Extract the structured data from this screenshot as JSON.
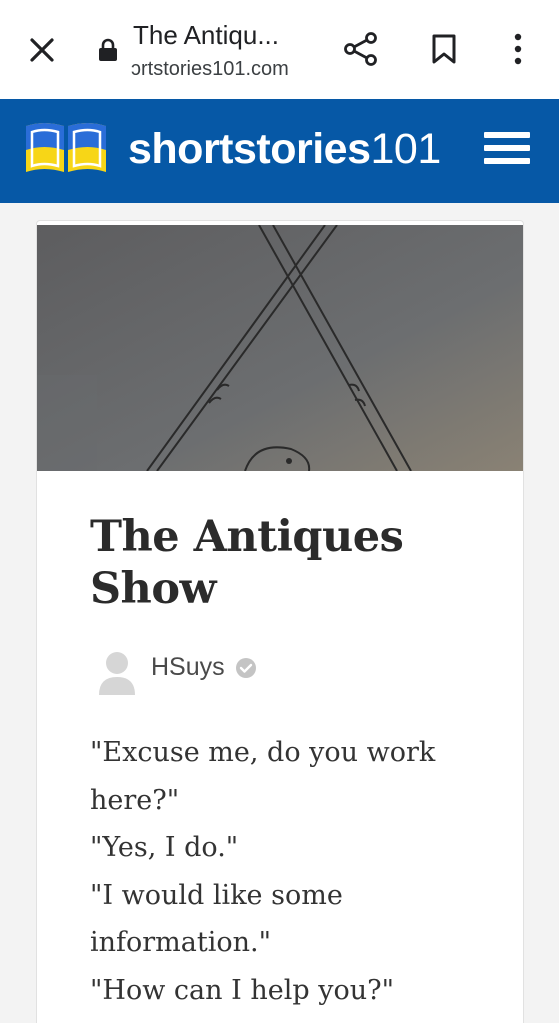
{
  "browser": {
    "title": "The Antiqu...",
    "url": "ɔrtstories101.com",
    "icons": [
      "close-icon",
      "lock-icon",
      "share-icon",
      "bookmark-icon",
      "more-vert-icon"
    ]
  },
  "site": {
    "brand_bold": "shortstories",
    "brand_num": "101",
    "colors": {
      "header": "#0658a6",
      "logo_blue": "#2a6dd8",
      "logo_yellow": "#f7d617"
    }
  },
  "story": {
    "title_line1": "The Antiques",
    "title_line2": "Show",
    "author": "HSuys",
    "paragraphs": [
      "\"Excuse me, do you work",
      "here?\"",
      "\"Yes, I do.\"",
      "\"I would like some",
      "information.\"",
      "\"How can I help you?\""
    ]
  }
}
